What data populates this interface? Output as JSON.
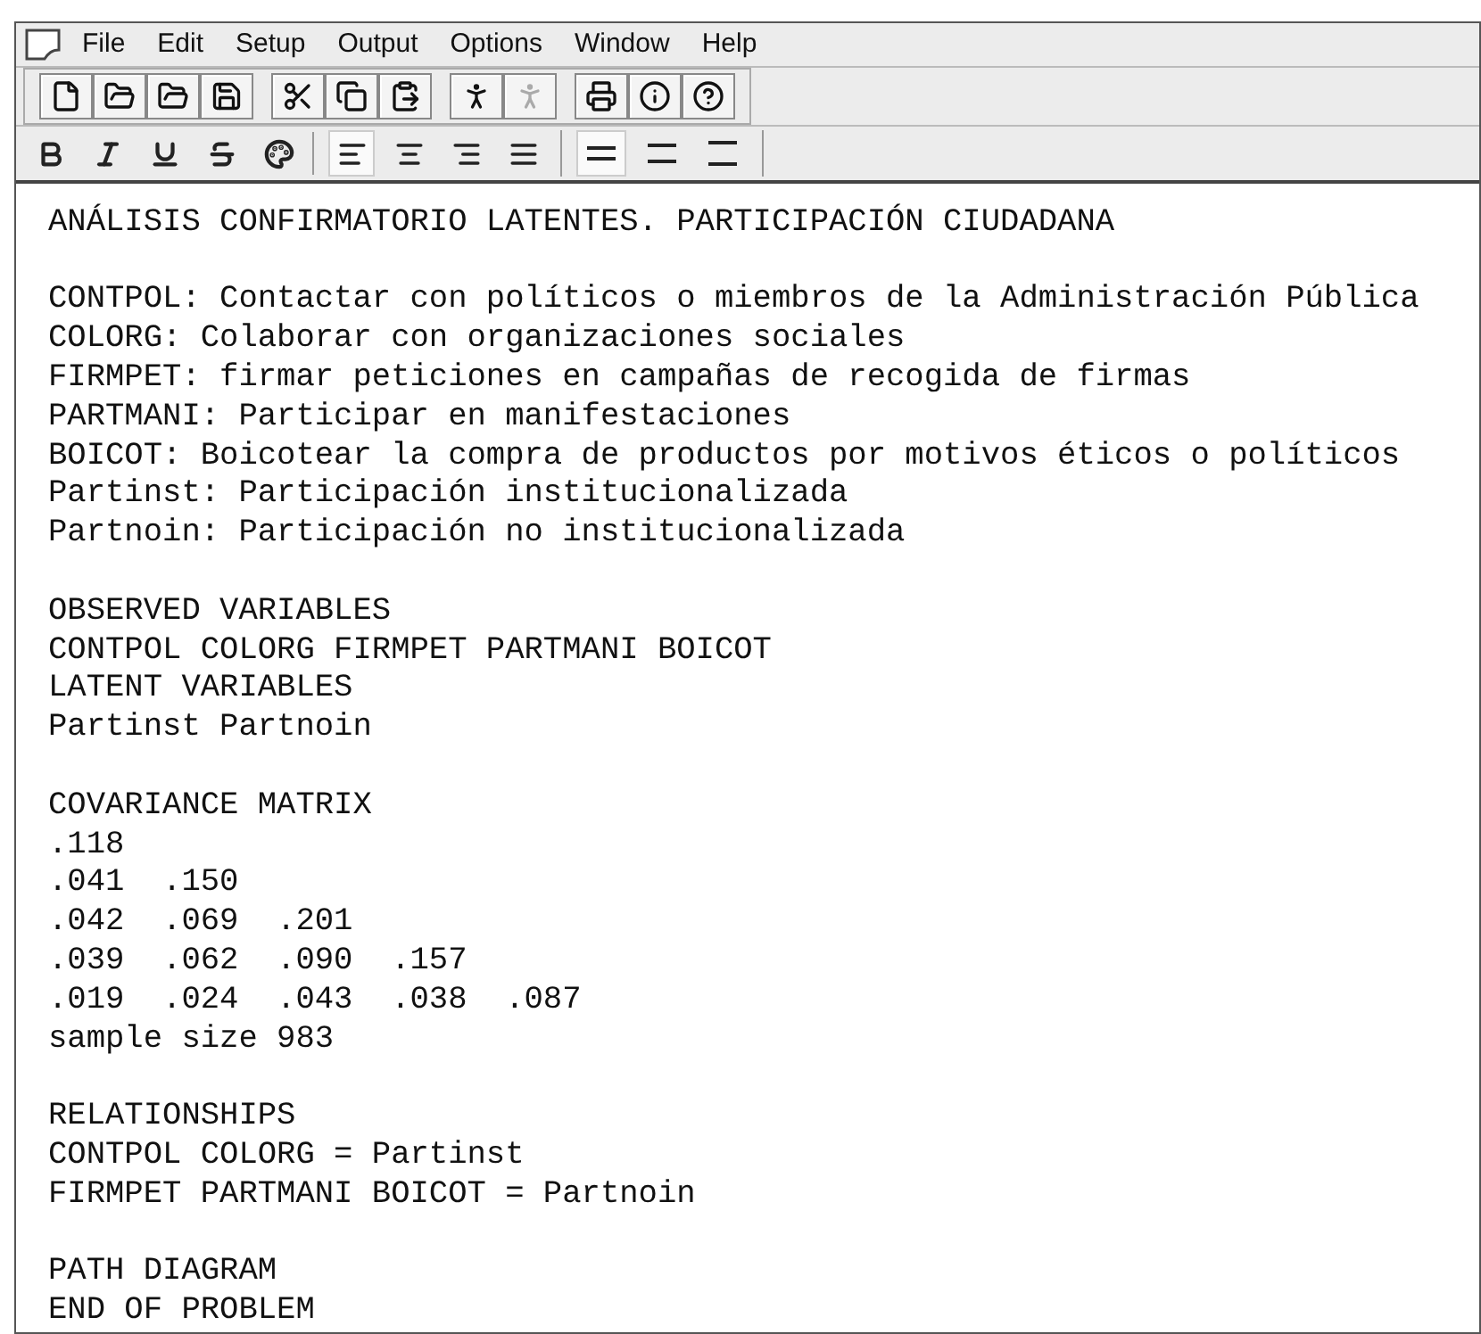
{
  "menu": [
    "File",
    "Edit",
    "Setup",
    "Output",
    "Options",
    "Window",
    "Help"
  ],
  "toolbar": [
    [
      {
        "kind": "new",
        "disabled": false
      },
      {
        "kind": "open",
        "disabled": false
      },
      {
        "kind": "open-dark",
        "disabled": false
      },
      {
        "kind": "save",
        "disabled": false
      }
    ],
    [
      {
        "kind": "cut",
        "disabled": false
      },
      {
        "kind": "copy",
        "disabled": false
      },
      {
        "kind": "paste",
        "disabled": false
      }
    ],
    [
      {
        "kind": "run",
        "disabled": false
      },
      {
        "kind": "run",
        "disabled": true
      }
    ],
    [
      {
        "kind": "print",
        "disabled": false
      },
      {
        "kind": "info",
        "disabled": false
      },
      {
        "kind": "help",
        "disabled": false
      }
    ]
  ],
  "format": {
    "styles": [
      {
        "kind": "bold"
      },
      {
        "kind": "italic"
      },
      {
        "kind": "underline"
      },
      {
        "kind": "strike"
      },
      {
        "kind": "color"
      }
    ],
    "align": [
      {
        "kind": "left",
        "selected": true
      },
      {
        "kind": "center",
        "selected": false
      },
      {
        "kind": "right",
        "selected": false
      },
      {
        "kind": "justify",
        "selected": false
      }
    ],
    "spacing": [
      {
        "kind": "single",
        "selected": true
      },
      {
        "kind": "oneandhalf",
        "selected": false
      },
      {
        "kind": "double",
        "selected": false
      }
    ]
  },
  "editor": {
    "blocks": [
      [
        "ANÁLISIS CONFIRMATORIO LATENTES. PARTICIPACIÓN CIUDADANA"
      ],
      [
        "CONTPOL: Contactar con políticos o miembros de la Administración Pública",
        "COLORG: Colaborar con organizaciones sociales",
        "FIRMPET: firmar peticiones en campañas de recogida de firmas",
        "PARTMANI: Participar en manifestaciones",
        "BOICOT: Boicotear la compra de productos por motivos éticos o políticos",
        "Partinst: Participación institucionalizada",
        "Partnoin: Participación no institucionalizada"
      ],
      [
        "OBSERVED VARIABLES",
        "CONTPOL COLORG FIRMPET PARTMANI BOICOT",
        "LATENT VARIABLES",
        "Partinst Partnoin"
      ],
      [
        "COVARIANCE MATRIX",
        ".118",
        ".041  .150",
        ".042  .069  .201",
        ".039  .062  .090  .157",
        ".019  .024  .043  .038  .087",
        "sample size 983"
      ],
      [
        "RELATIONSHIPS",
        "CONTPOL COLORG = Partinst",
        "FIRMPET PARTMANI BOICOT = Partnoin"
      ],
      [
        "PATH DIAGRAM",
        "END OF PROBLEM"
      ]
    ]
  }
}
